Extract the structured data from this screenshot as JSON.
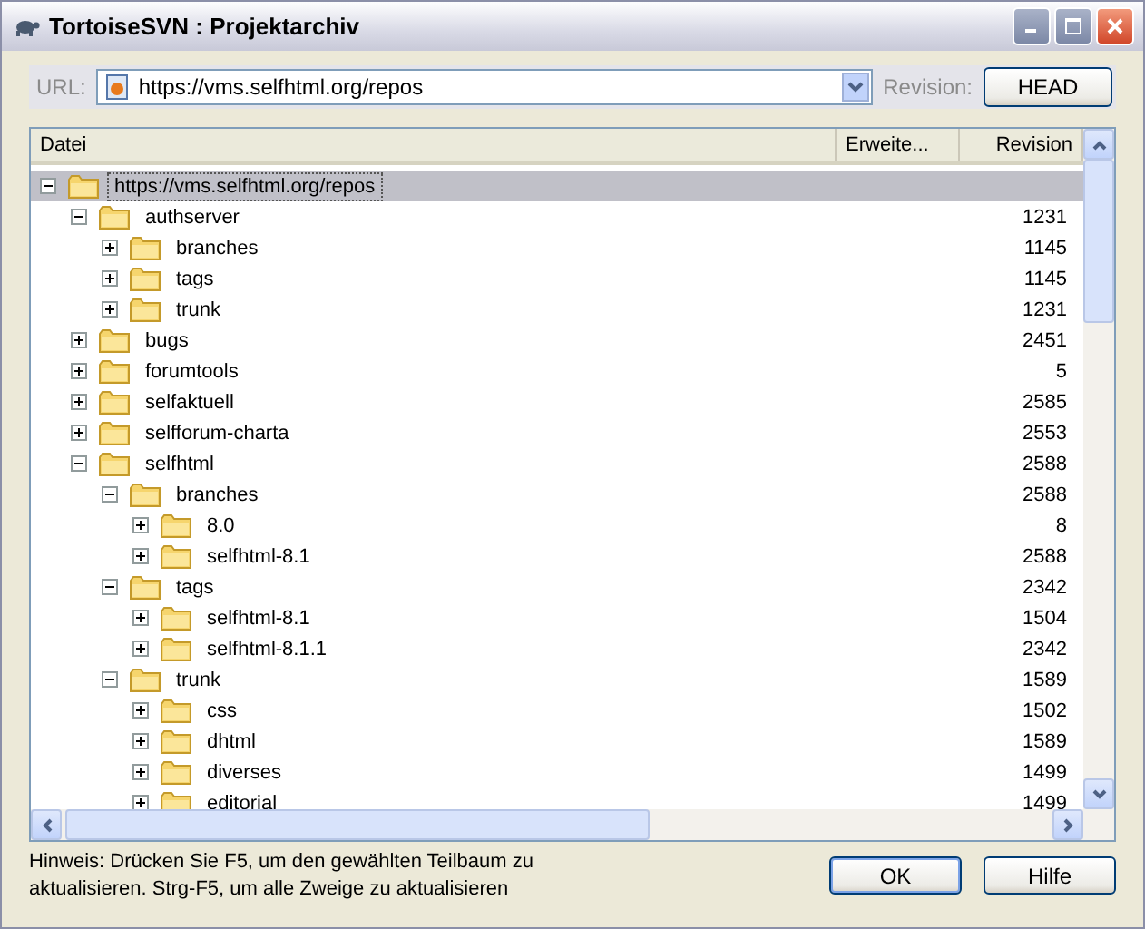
{
  "window": {
    "title": "TortoiseSVN : Projektarchiv"
  },
  "url": {
    "label": "URL:",
    "value": "https://vms.selfhtml.org/repos"
  },
  "revision": {
    "label": "Revision:",
    "button": "HEAD"
  },
  "columns": [
    "Datei",
    "Erweite...",
    "Revision"
  ],
  "tree": [
    {
      "name": "https://vms.selfhtml.org/repos",
      "expanded": true,
      "selected": true,
      "children": [
        {
          "name": "authserver",
          "revision": "1231",
          "expanded": true,
          "selected": false,
          "children": [
            {
              "name": "branches",
              "revision": "1145",
              "expanded": false,
              "selected": false
            },
            {
              "name": "tags",
              "revision": "1145",
              "expanded": false,
              "selected": false
            },
            {
              "name": "trunk",
              "revision": "1231",
              "expanded": false,
              "selected": false
            }
          ]
        },
        {
          "name": "bugs",
          "revision": "2451",
          "expanded": false,
          "selected": false
        },
        {
          "name": "forumtools",
          "revision": "5",
          "expanded": false,
          "selected": false
        },
        {
          "name": "selfaktuell",
          "revision": "2585",
          "expanded": false,
          "selected": false
        },
        {
          "name": "selfforum-charta",
          "revision": "2553",
          "expanded": false,
          "selected": false
        },
        {
          "name": "selfhtml",
          "revision": "2588",
          "expanded": true,
          "selected": false,
          "children": [
            {
              "name": "branches",
              "revision": "2588",
              "expanded": true,
              "selected": false,
              "children": [
                {
                  "name": "8.0",
                  "revision": "8",
                  "expanded": false,
                  "selected": false
                },
                {
                  "name": "selfhtml-8.1",
                  "revision": "2588",
                  "expanded": false,
                  "selected": false
                }
              ]
            },
            {
              "name": "tags",
              "revision": "2342",
              "expanded": true,
              "selected": false,
              "children": [
                {
                  "name": "selfhtml-8.1",
                  "revision": "1504",
                  "expanded": false,
                  "selected": false
                },
                {
                  "name": "selfhtml-8.1.1",
                  "revision": "2342",
                  "expanded": false,
                  "selected": false
                }
              ]
            },
            {
              "name": "trunk",
              "revision": "1589",
              "expanded": true,
              "selected": false,
              "children": [
                {
                  "name": "css",
                  "revision": "1502",
                  "expanded": false,
                  "selected": false
                },
                {
                  "name": "dhtml",
                  "revision": "1589",
                  "expanded": false,
                  "selected": false
                },
                {
                  "name": "diverses",
                  "revision": "1499",
                  "expanded": false,
                  "selected": false
                },
                {
                  "name": "editorial",
                  "revision": "1499",
                  "expanded": false,
                  "selected": false
                }
              ]
            }
          ]
        }
      ]
    }
  ],
  "hint": "Hinweis: Drücken Sie F5, um den gewählten Teilbaum zu aktualisieren. Strg-F5, um alle Zweige zu aktualisieren",
  "buttons": [
    "OK",
    "Hilfe"
  ]
}
